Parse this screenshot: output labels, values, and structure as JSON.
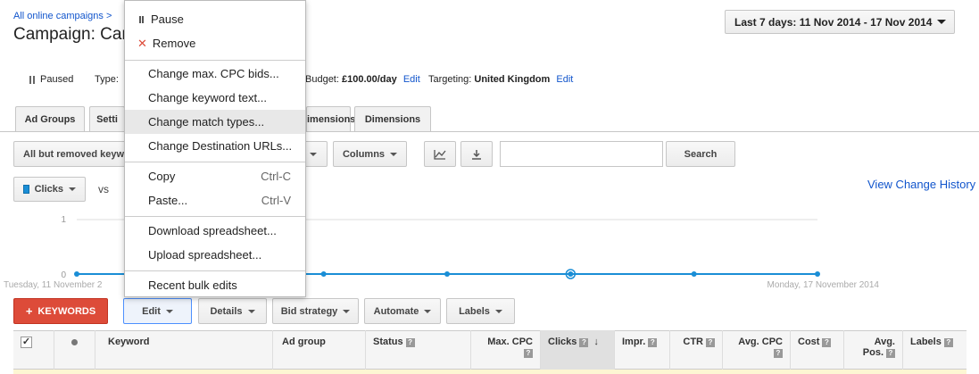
{
  "breadcrumb": "All online campaigns >",
  "campaign_title": "Campaign: Cam",
  "date_range": "Last 7 days: 11 Nov 2014 - 17 Nov 2014",
  "status_row": {
    "status": "Paused",
    "type_label": "Type:",
    "budget_label": "Budget:",
    "budget_value": "£100.00/day",
    "budget_edit": "Edit",
    "targeting_label": "Targeting:",
    "targeting_value": "United Kingdom",
    "targeting_edit": "Edit"
  },
  "tabs": [
    "Ad Groups",
    "Setti",
    "imensions",
    "Dimensions"
  ],
  "toolbar": {
    "filter": "All but removed keyw",
    "columns": "Columns",
    "search_placeholder": "",
    "search": "Search"
  },
  "chart_controls": {
    "metric": "Clicks",
    "vs": "vs",
    "view_change_history": "View Change History"
  },
  "chart_data": {
    "type": "line",
    "y_ticks": [
      "1",
      "0"
    ],
    "x_start_label": "Tuesday, 11 November 2",
    "x_end_label": "Monday, 17 November 2014",
    "series": [
      {
        "values": [
          0,
          0,
          0,
          0,
          0,
          0,
          0,
          0,
          0,
          0,
          0,
          0,
          0
        ]
      }
    ],
    "ylim": [
      0,
      1
    ],
    "highlight_index": 8,
    "metric_color": "#1a8ed6"
  },
  "actions": {
    "add_keywords": "KEYWORDS",
    "edit": "Edit",
    "details": "Details",
    "bid_strategy": "Bid strategy",
    "automate": "Automate",
    "labels": "Labels"
  },
  "table": {
    "headers": [
      "Keyword",
      "Ad group",
      "Status",
      "Max. CPC",
      "Clicks",
      "Impr.",
      "CTR",
      "Avg. CPC",
      "Cost",
      "Avg. Pos.",
      "Labels"
    ]
  },
  "menu": {
    "pause": "Pause",
    "remove": "Remove",
    "change_bids": "Change max. CPC bids...",
    "change_text": "Change keyword text...",
    "change_match": "Change match types...",
    "change_urls": "Change Destination URLs...",
    "copy": "Copy",
    "copy_shortcut": "Ctrl-C",
    "paste": "Paste...",
    "paste_shortcut": "Ctrl-V",
    "download": "Download spreadsheet...",
    "upload": "Upload spreadsheet...",
    "recent": "Recent bulk edits"
  }
}
